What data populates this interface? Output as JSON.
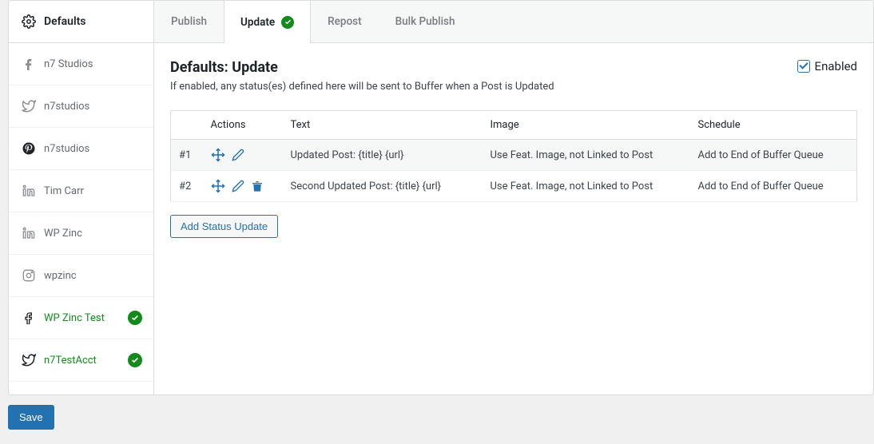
{
  "sidebar": {
    "header": "Defaults",
    "items": [
      {
        "label": "n7 Studios",
        "network": "facebook",
        "active": false
      },
      {
        "label": "n7studios",
        "network": "twitter",
        "active": false
      },
      {
        "label": "n7studios",
        "network": "pinterest",
        "active": false
      },
      {
        "label": "Tim Carr",
        "network": "linkedin",
        "active": false
      },
      {
        "label": "WP Zinc",
        "network": "linkedin",
        "active": false
      },
      {
        "label": "wpzinc",
        "network": "instagram",
        "active": false
      },
      {
        "label": "WP Zinc Test",
        "network": "facebook",
        "active": true
      },
      {
        "label": "n7TestAcct",
        "network": "twitter",
        "active": true
      }
    ]
  },
  "tabs": [
    {
      "label": "Publish",
      "active": false,
      "check": false
    },
    {
      "label": "Update",
      "active": true,
      "check": true
    },
    {
      "label": "Repost",
      "active": false,
      "check": false
    },
    {
      "label": "Bulk Publish",
      "active": false,
      "check": false
    }
  ],
  "page": {
    "title": "Defaults: Update",
    "desc": "If enabled, any status(es) defined here will be sent to Buffer when a Post is Updated",
    "enabled_label": "Enabled",
    "enabled": true
  },
  "table": {
    "headers": {
      "actions": "Actions",
      "text": "Text",
      "image": "Image",
      "schedule": "Schedule"
    },
    "rows": [
      {
        "idx": "#1",
        "text": "Updated Post: {title} {url}",
        "image": "Use Feat. Image, not Linked to Post",
        "schedule": "Add to End of Buffer Queue",
        "deletable": false
      },
      {
        "idx": "#2",
        "text": "Second Updated Post: {title} {url}",
        "image": "Use Feat. Image, not Linked to Post",
        "schedule": "Add to End of Buffer Queue",
        "deletable": true
      }
    ]
  },
  "buttons": {
    "add": "Add Status Update",
    "save": "Save"
  }
}
